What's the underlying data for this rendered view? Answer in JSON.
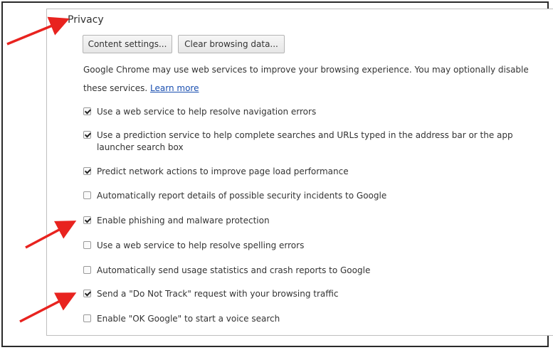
{
  "section": {
    "title": "Privacy"
  },
  "buttons": {
    "content_settings": "Content settings...",
    "clear_browsing_data": "Clear browsing data..."
  },
  "description": {
    "text": "Google Chrome may use web services to improve your browsing experience. You may optionally disable these services.",
    "learn_more": "Learn more"
  },
  "options": [
    {
      "label": "Use a web service to help resolve navigation errors",
      "checked": true
    },
    {
      "label": "Use a prediction service to help complete searches and URLs typed in the address bar or the app launcher search box",
      "checked": true
    },
    {
      "label": "Predict network actions to improve page load performance",
      "checked": true
    },
    {
      "label": "Automatically report details of possible security incidents to Google",
      "checked": false
    },
    {
      "label": "Enable phishing and malware protection",
      "checked": true
    },
    {
      "label": "Use a web service to help resolve spelling errors",
      "checked": false
    },
    {
      "label": "Automatically send usage statistics and crash reports to Google",
      "checked": false
    },
    {
      "label": "Send a \"Do Not Track\" request with your browsing traffic",
      "checked": true
    },
    {
      "label": "Enable \"OK Google\" to start a voice search",
      "checked": false
    }
  ],
  "annotations": {
    "arrow_color": "#e8231f"
  }
}
